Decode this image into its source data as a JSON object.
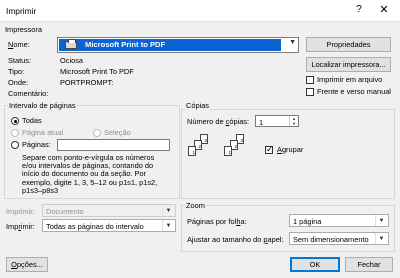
{
  "window": {
    "title": "Imprimir",
    "help_label": "?",
    "close_label": "✕"
  },
  "printer": {
    "group_label": "Impressora",
    "name_label": "Nome:",
    "selected_name": "Microsoft Print to PDF",
    "properties_button": "Propriedades",
    "find_button": "Localizar impressora...",
    "status_label": "Status:",
    "status_value": "Ociosa",
    "type_label": "Tipo:",
    "type_value": "Microsoft Print To PDF",
    "where_label": "Onde:",
    "where_value": "PORTPROMPT:",
    "comment_label": "Comentário:",
    "comment_value": "",
    "print_to_file_label": "Imprimir em arquivo",
    "print_to_file_checked": false,
    "duplex_label": "Frente e verso manual",
    "duplex_checked": false
  },
  "page_range": {
    "group_label": "Intervalo de páginas",
    "all_label": "Todas",
    "current_label": "Página atual",
    "selection_label": "Seleção",
    "pages_label": "Páginas:",
    "pages_value": "",
    "hint": "Separe com ponto-e-vírgula os números e/ou intervalos de páginas, contando do início do documento ou da seção. Por exemplo, digite 1, 3, 5–12 ou p1s1, p1s2, p1s3–p8s3",
    "hint_lines": [
      "Separe com ponto-e-vírgula os números",
      "e/ou intervalos de páginas, contando do",
      "início do documento ou da seção. Por",
      "exemplo, digite 1, 3, 5–12 ou p1s1, p1s2,",
      "p1s3–p8s3"
    ]
  },
  "copies": {
    "group_label": "Cópias",
    "count_label": "Número de cópias:",
    "count_value": "1",
    "collate_label": "Agrupar",
    "collate_checked": true,
    "page_numbers": [
      "3",
      "2",
      "1"
    ]
  },
  "print_what": {
    "label": "Imprimir:",
    "value": "Documento"
  },
  "print_pages": {
    "label": "Imprimir:",
    "value": "Todas as páginas do intervalo"
  },
  "zoom": {
    "group_label": "Zoom",
    "per_sheet_label": "Páginas por folha:",
    "per_sheet_value": "1 página",
    "scale_label": "Ajustar ao tamanho do papel:",
    "scale_value": "Sem dimensionamento"
  },
  "buttons": {
    "options": "Opções...",
    "ok": "OK",
    "cancel": "Fechar"
  }
}
